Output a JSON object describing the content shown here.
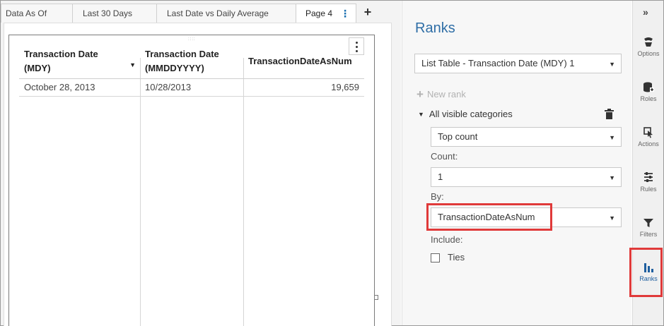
{
  "tabs": [
    {
      "label": "Data As Of"
    },
    {
      "label": "Last 30 Days"
    },
    {
      "label": "Last Date vs Daily Average"
    },
    {
      "label": "Page 4"
    }
  ],
  "tab_add_label": "+",
  "table": {
    "headers": [
      {
        "line1": "Transaction Date",
        "line2": "(MDY)"
      },
      {
        "line1": "Transaction Date",
        "line2": "(MMDDYYYY)"
      },
      {
        "line1": "TransactionDateAsNum",
        "line2": ""
      }
    ],
    "rows": [
      [
        "October 28, 2013",
        "10/28/2013",
        "19,659"
      ]
    ]
  },
  "panel": {
    "title": "Ranks",
    "object_select": "List Table - Transaction Date (MDY) 1",
    "new_rank_label": "New rank",
    "group_label": "All visible categories",
    "rank_type": "Top count",
    "count_label": "Count:",
    "count_value": "1",
    "by_label": "By:",
    "by_value": "TransactionDateAsNum",
    "include_label": "Include:",
    "ties_label": "Ties",
    "ties_checked": false
  },
  "rail": {
    "collapse_label": "»",
    "items": [
      {
        "label": "Options",
        "icon": "options-icon"
      },
      {
        "label": "Roles",
        "icon": "roles-icon"
      },
      {
        "label": "Actions",
        "icon": "actions-icon"
      },
      {
        "label": "Rules",
        "icon": "rules-icon"
      },
      {
        "label": "Filters",
        "icon": "filter-icon"
      },
      {
        "label": "Ranks",
        "icon": "ranks-icon",
        "active": true
      }
    ]
  },
  "colors": {
    "accent": "#2f6ea6",
    "highlight": "#e03a3a"
  }
}
